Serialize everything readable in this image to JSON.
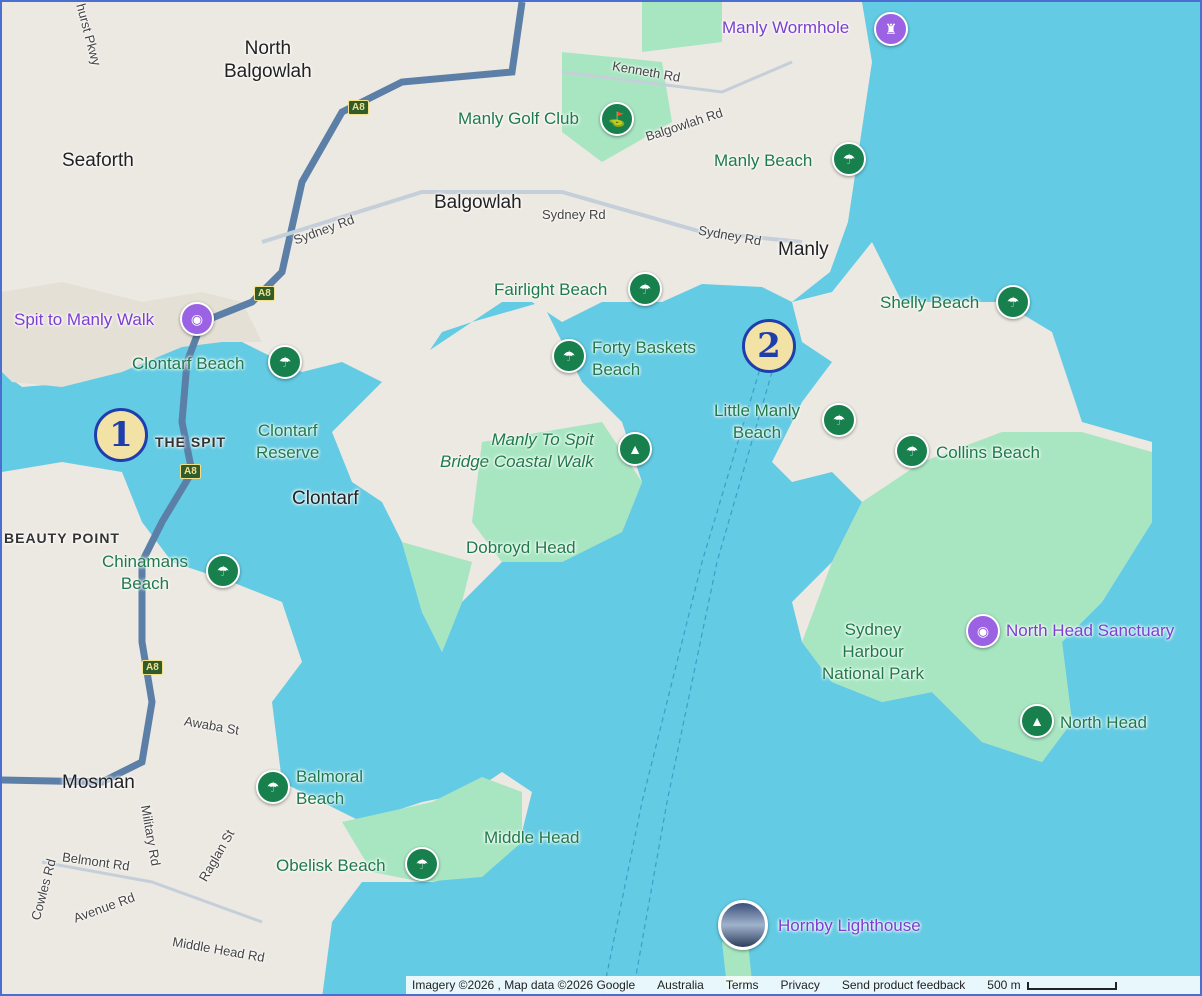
{
  "suburbs": {
    "north_balgowlah": "North\nBalgowlah",
    "seaforth": "Seaforth",
    "balgowlah": "Balgowlah",
    "manly": "Manly",
    "clontarf": "Clontarf",
    "mosman": "Mosman",
    "the_spit": "THE SPIT",
    "beauty_point": "BEAUTY POINT"
  },
  "streets": {
    "kenneth_rd": "Kenneth Rd",
    "balgowlah_rd": "Balgowlah Rd",
    "sydney_rd_1": "Sydney Rd",
    "sydney_rd_2": "Sydney Rd",
    "sydney_rd_3": "Sydney Rd",
    "awaba_st": "Awaba St",
    "military_rd": "Military Rd",
    "belmont_rd": "Belmont Rd",
    "raglan_st": "Raglan St",
    "cowles_rd": "Cowles Rd",
    "avenue_rd": "Avenue Rd",
    "middle_head_rd": "Middle Head Rd",
    "hurst_pkwy": "hurst Pkwy"
  },
  "shields": {
    "route": "A8"
  },
  "places": {
    "manly_wormhole": "Manly Wormhole",
    "manly_golf_club": "Manly Golf Club",
    "manly_beach": "Manly Beach",
    "fairlight_beach": "Fairlight Beach",
    "shelly_beach": "Shelly Beach",
    "spit_to_manly_walk": "Spit to Manly Walk",
    "clontarf_beach": "Clontarf Beach",
    "forty_baskets_beach": "Forty Baskets\nBeach",
    "little_manly_beach": "Little Manly\nBeach",
    "collins_beach": "Collins Beach",
    "clontarf_reserve": "Clontarf\nReserve",
    "coastal_walk": "Manly To Spit\nBridge Coastal Walk",
    "dobroyd_head": "Dobroyd Head",
    "chinamans_beach": "Chinamans\nBeach",
    "sydney_harbour_np": "Sydney\nHarbour\nNational Park",
    "north_head_sanctuary": "North Head Sanctuary",
    "north_head": "North Head",
    "balmoral_beach": "Balmoral\nBeach",
    "middle_head": "Middle Head",
    "obelisk_beach": "Obelisk Beach",
    "hornby_lighthouse": "Hornby Lighthouse"
  },
  "markers": {
    "one": "1",
    "two": "2"
  },
  "footer": {
    "attribution": "Imagery ©2026 , Map data ©2026 Google",
    "country": "Australia",
    "terms": "Terms",
    "privacy": "Privacy",
    "feedback": "Send product feedback",
    "scale": "500 m"
  },
  "colors": {
    "water": "#63cbe3",
    "land": "#ece8e2",
    "park": "#a8e6c2",
    "road": "#5b7fa6",
    "beach_pin": "#17804c",
    "poi_pin": "#9b63e3"
  }
}
